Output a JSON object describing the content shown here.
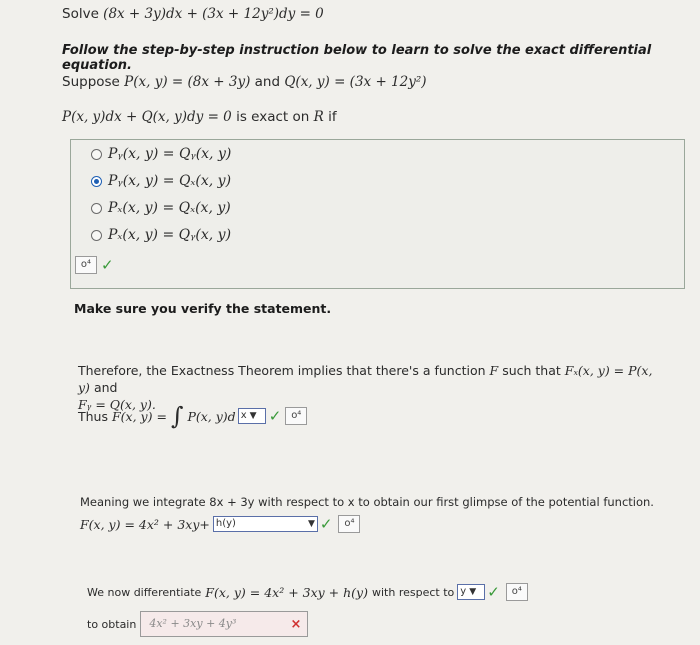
{
  "header": {
    "solve_prefix": "Solve",
    "equation": "(8x + 3y)dx + (3x + 12y²)dy = 0"
  },
  "instruction": "Follow the step-by-step instruction below to learn to solve the exact differential equation.",
  "suppose": {
    "prefix": "Suppose",
    "p_def": "P(x, y) = (8x + 3y)",
    "and": "and",
    "q_def": "Q(x, y) = (3x + 12y²)"
  },
  "exact_statement": {
    "math": "P(x, y)dx + Q(x, y)dy = 0",
    "text": "is exact on",
    "region": "R",
    "suffix": "if"
  },
  "options": [
    {
      "label": "Pᵧ(x, y) = Qᵧ(x, y)",
      "selected": false
    },
    {
      "label": "Pᵧ(x, y) = Qₓ(x, y)",
      "selected": true
    },
    {
      "label": "Pₓ(x, y) = Qₓ(x, y)",
      "selected": false
    },
    {
      "label": "Pₓ(x, y) = Qᵧ(x, y)",
      "selected": false
    }
  ],
  "key_icon_label": "o⁴",
  "check_mark": "✓",
  "x_mark": "×",
  "verify_text": "Make sure you verify the statement.",
  "therefore": {
    "line1_text": "Therefore, the Exactness Theorem implies that there's a function",
    "F": "F",
    "line1_mid": "such that",
    "fx_eq": "Fₓ(x, y) = P(x, y)",
    "and": "and",
    "line2": "Fᵧ = Q(x, y)."
  },
  "thus": {
    "prefix": "Thus",
    "lhs": "F(x, y) =",
    "integral": "∫",
    "integrand": "P(x, y)d",
    "dropdown_value": "x"
  },
  "meaning": {
    "text": "Meaning we integrate 8x + 3y with respect to x to obtain our first glimpse of the potential function.",
    "formula": "F(x, y) = 4x² + 3xy+",
    "dropdown_value": "h(y)"
  },
  "differentiate": {
    "text_a": "We now differentiate",
    "formula": "F(x, y) = 4x² + 3xy + h(y)",
    "text_b": "with respect to",
    "dropdown_value": "y"
  },
  "obtain": {
    "label": "to obtain",
    "answer": "4x² + 3xy + 4y³"
  }
}
